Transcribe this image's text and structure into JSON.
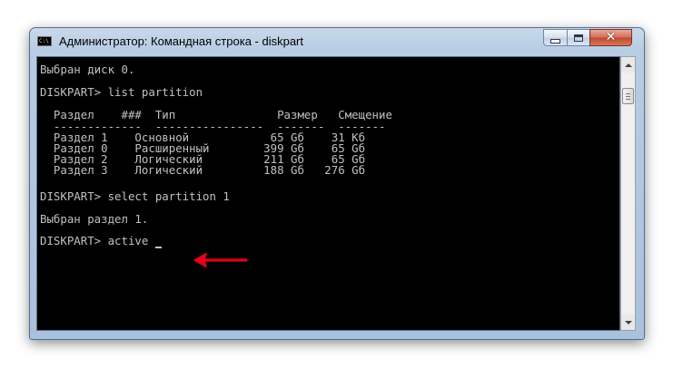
{
  "window": {
    "title": "Администратор: Командная строка - diskpart",
    "app_icon_text": "C:\\"
  },
  "console": {
    "lines": [
      "Выбран диск 0.",
      "",
      "DISKPART> list partition",
      "",
      "  Раздел    ###  Тип               Размер   Смещение",
      "  -------------  ----------------  -------  -------",
      "  Раздел 1    Основной            65 Gб    31 Kб",
      "  Раздел 0    Расширенный        399 Gб    65 Gб",
      "  Раздел 2    Логический         211 Gб    65 Gб",
      "  Раздел 3    Логический         188 Gб   276 Gб",
      "",
      "DISKPART> select partition 1",
      "",
      "Выбран раздел 1.",
      "",
      "DISKPART> active"
    ]
  },
  "colors": {
    "console_bg": "#000000",
    "console_text": "#c0c0c0",
    "annotation_arrow": "#e3001b"
  }
}
